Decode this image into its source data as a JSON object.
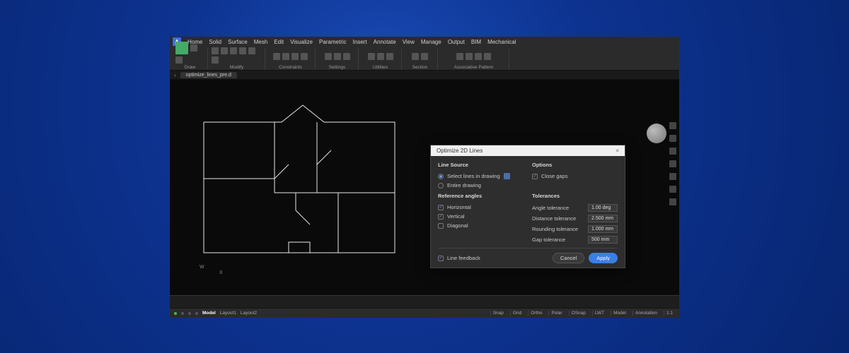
{
  "menubar": {
    "logo": "A",
    "items": [
      "Home",
      "Solid",
      "Surface",
      "Mesh",
      "Edit",
      "Visualize",
      "Parametric",
      "Insert",
      "Annotate",
      "View",
      "Manage",
      "Output",
      "BIM",
      "Mechanical"
    ]
  },
  "ribbon_groups": [
    "Draw",
    "Modify",
    "Constraints",
    "Settings",
    "Utilities",
    "Section",
    "Associative Pattern"
  ],
  "doctab": {
    "name": "optimize_lines_pre.d",
    "start_chev": "‹"
  },
  "dialog": {
    "title": "Optimize 2D Lines",
    "sections": {
      "line_source": {
        "head": "Line Source",
        "opt_select": "Select lines in drawing",
        "opt_entire": "Entire drawing"
      },
      "options": {
        "head": "Options",
        "check_closegaps": "Close gaps"
      },
      "reference_angles": {
        "head": "Reference angles",
        "horiz": "Horizontal",
        "vert": "Vertical",
        "diag": "Diagonal"
      },
      "tolerances": {
        "head": "Tolerances",
        "angle_label": "Angle tolerance",
        "angle_val": "1.00 deg",
        "distance_label": "Distance tolerance",
        "distance_val": "2.500 mm",
        "rounding_label": "Rounding tolerance",
        "rounding_val": "1.000 mm",
        "gap_label": "Gap tolerance",
        "gap_val": "500 mm"
      }
    },
    "footer": {
      "feedback": "Line feedback",
      "cancel": "Cancel",
      "apply": "Apply"
    }
  },
  "status": {
    "tabs": [
      "Model",
      "Layout1",
      "Layout2"
    ],
    "right": [
      "Snap",
      "Grid",
      "Ortho",
      "Polar",
      "OSnap",
      "LWT",
      "Model",
      "Annotation",
      "1:1"
    ]
  },
  "coord": {
    "w": "W",
    "x": "X"
  }
}
